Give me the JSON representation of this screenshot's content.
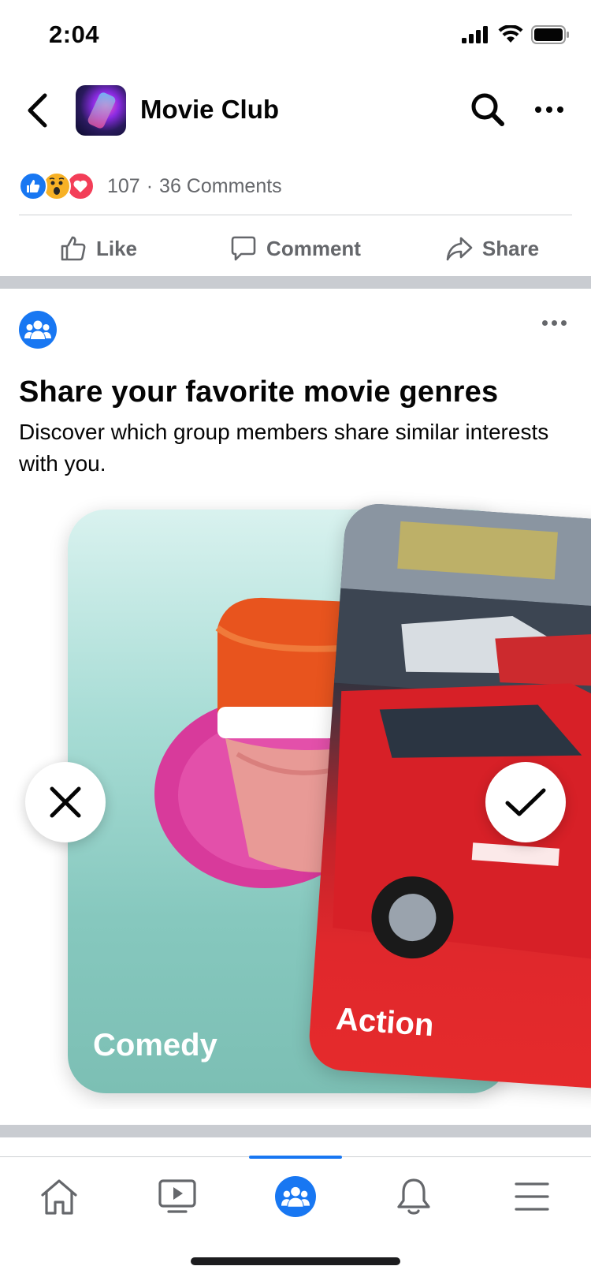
{
  "status_bar": {
    "time": "2:04"
  },
  "header": {
    "group_name": "Movie Club"
  },
  "post_stats": {
    "reaction_count": "107",
    "separator": "·",
    "comments": "36 Comments"
  },
  "actions": {
    "like": "Like",
    "comment": "Comment",
    "share": "Share"
  },
  "prompt_post": {
    "title": "Share your favorite movie genres",
    "description": "Discover which group members share similar interests with you."
  },
  "cards": [
    {
      "label": "Comedy"
    },
    {
      "label": "Action"
    }
  ],
  "nav": {
    "items": [
      "home-icon",
      "watch-icon",
      "groups-icon",
      "notifications-icon",
      "menu-icon"
    ],
    "active": "groups-icon"
  },
  "colors": {
    "accent": "#1877f2",
    "secondary_text": "#65676b",
    "action_card": "#e52a2c",
    "comedy_card": "#7cbfb4"
  }
}
